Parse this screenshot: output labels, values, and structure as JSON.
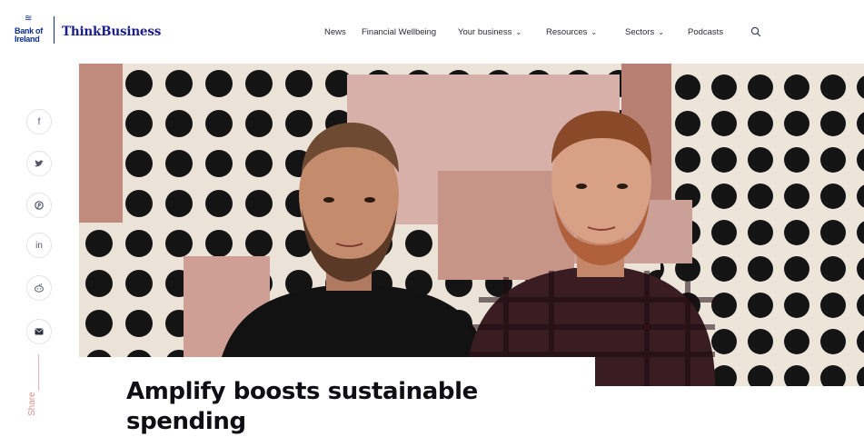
{
  "header": {
    "bank_logo_line1": "Bank of",
    "bank_logo_line2": "Ireland",
    "brand": "ThinkBusiness",
    "nav": [
      {
        "label": "News"
      },
      {
        "label": "Financial Wellbeing"
      },
      {
        "label": "Your business"
      },
      {
        "label": "Resources"
      },
      {
        "label": "Sectors"
      },
      {
        "label": "Podcasts"
      }
    ],
    "search_icon": "search-icon"
  },
  "share": {
    "label": "Share",
    "buttons": [
      {
        "icon": "facebook-icon",
        "glyph": "f"
      },
      {
        "icon": "twitter-icon",
        "glyph": "🐦"
      },
      {
        "icon": "pinterest-icon",
        "glyph": "℗"
      },
      {
        "icon": "linkedin-icon",
        "glyph": "in"
      },
      {
        "icon": "reddit-icon",
        "glyph": "☺"
      },
      {
        "icon": "email-icon",
        "glyph": "✉"
      }
    ]
  },
  "article": {
    "title": "Amplify boosts sustainable spending"
  },
  "colors": {
    "brand_blue": "#1a1d8c",
    "share_accent": "#d98f8f",
    "hero_wall_pink": "#c49a8f",
    "hero_dot": "#141414"
  }
}
